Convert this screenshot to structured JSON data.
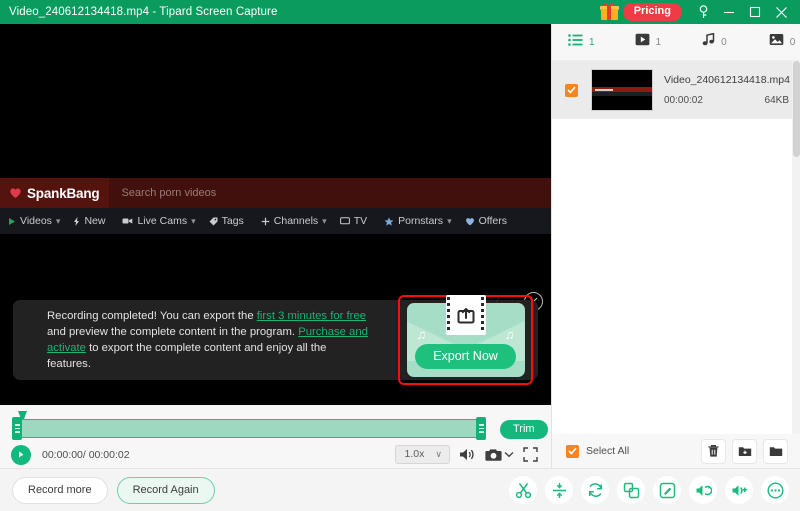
{
  "titlebar": {
    "title": "Video_240612134418.mp4  -  Tipard Screen Capture",
    "pricing_label": "Pricing",
    "gift_icon": "gift-icon",
    "key_icon": "key-icon",
    "minimize_icon": "minimize-icon",
    "maximize_icon": "maximize-icon",
    "close_icon": "close-icon",
    "accent_color": "#0a9c5f",
    "pricing_color": "#ef3b45"
  },
  "preview": {
    "site": {
      "logo_text": "SpankBang",
      "logo_icon": "heart-icon",
      "search_placeholder": "Search porn videos",
      "header_color": "#54130d",
      "nav": [
        {
          "label": "Videos",
          "icon": "play-icon",
          "caret": "▾"
        },
        {
          "label": "New",
          "icon": "lightning-icon",
          "caret": ""
        },
        {
          "label": "Live Cams",
          "icon": "camera-icon",
          "caret": "▾"
        },
        {
          "label": "Tags",
          "icon": "tag-icon",
          "caret": ""
        },
        {
          "label": "Channels",
          "icon": "plus-icon",
          "caret": "▾"
        },
        {
          "label": "TV",
          "icon": "tv-icon",
          "caret": ""
        },
        {
          "label": "Pornstars",
          "icon": "star-icon",
          "caret": "▾"
        },
        {
          "label": "Offers",
          "icon": "heart-icon",
          "caret": ""
        }
      ]
    },
    "close_overlay_icon": "close-circle-icon"
  },
  "export_dialog": {
    "message_part1": "Recording completed! You can export the ",
    "link1": "first 3 minutes for free",
    "message_part2": " and preview the complete content in the program. ",
    "link2": "Purchase and activate",
    "message_part3": " to export the complete content and enjoy all the features.",
    "export_button_label": "Export Now",
    "card_icon": "share-film-icon",
    "highlight_color": "#fa0d0d",
    "button_color": "#1ec07d"
  },
  "player": {
    "trim_label": "Trim",
    "play_icon": "play-icon",
    "time_text": "00:00:00/ 00:00:02",
    "speed_value": "1.0x",
    "speed_caret": "∨",
    "volume_icon": "volume-icon",
    "snapshot_icon": "camera-icon",
    "snapshot_caret_icon": "chevron-down-icon",
    "fullscreen_icon": "fullscreen-icon",
    "track_color": "#9ed8c0"
  },
  "right_panel": {
    "tabs": [
      {
        "icon": "list-icon",
        "count": "1",
        "active": true
      },
      {
        "icon": "video-icon",
        "count": "1",
        "active": false
      },
      {
        "icon": "music-icon",
        "count": "0",
        "active": false
      },
      {
        "icon": "image-icon",
        "count": "0",
        "active": false
      }
    ],
    "files": [
      {
        "name": "Video_240612134418.mp4",
        "duration": "00:00:02",
        "size": "64KB",
        "checked": true
      }
    ],
    "select_all_label": "Select All",
    "select_all_checked": true,
    "actions": [
      {
        "icon": "trash-icon",
        "name": "delete-button"
      },
      {
        "icon": "folder-move-icon",
        "name": "move-to-folder-button"
      },
      {
        "icon": "folder-open-icon",
        "name": "open-folder-button"
      }
    ],
    "checkbox_color": "#f6841f"
  },
  "bottom_bar": {
    "record_more_label": "Record more",
    "record_again_label": "Record Again",
    "tools": [
      {
        "icon": "scissors-icon",
        "name": "cut-tool"
      },
      {
        "icon": "compress-icon",
        "name": "compress-tool"
      },
      {
        "icon": "convert-icon",
        "name": "convert-tool"
      },
      {
        "icon": "merge-icon",
        "name": "merge-tool"
      },
      {
        "icon": "edit-icon",
        "name": "edit-tool"
      },
      {
        "icon": "audio-extract-icon",
        "name": "audio-extract-tool"
      },
      {
        "icon": "volume-boost-icon",
        "name": "volume-boost-tool"
      },
      {
        "icon": "more-icon",
        "name": "more-tools"
      }
    ],
    "tool_color": "#1db97d"
  }
}
